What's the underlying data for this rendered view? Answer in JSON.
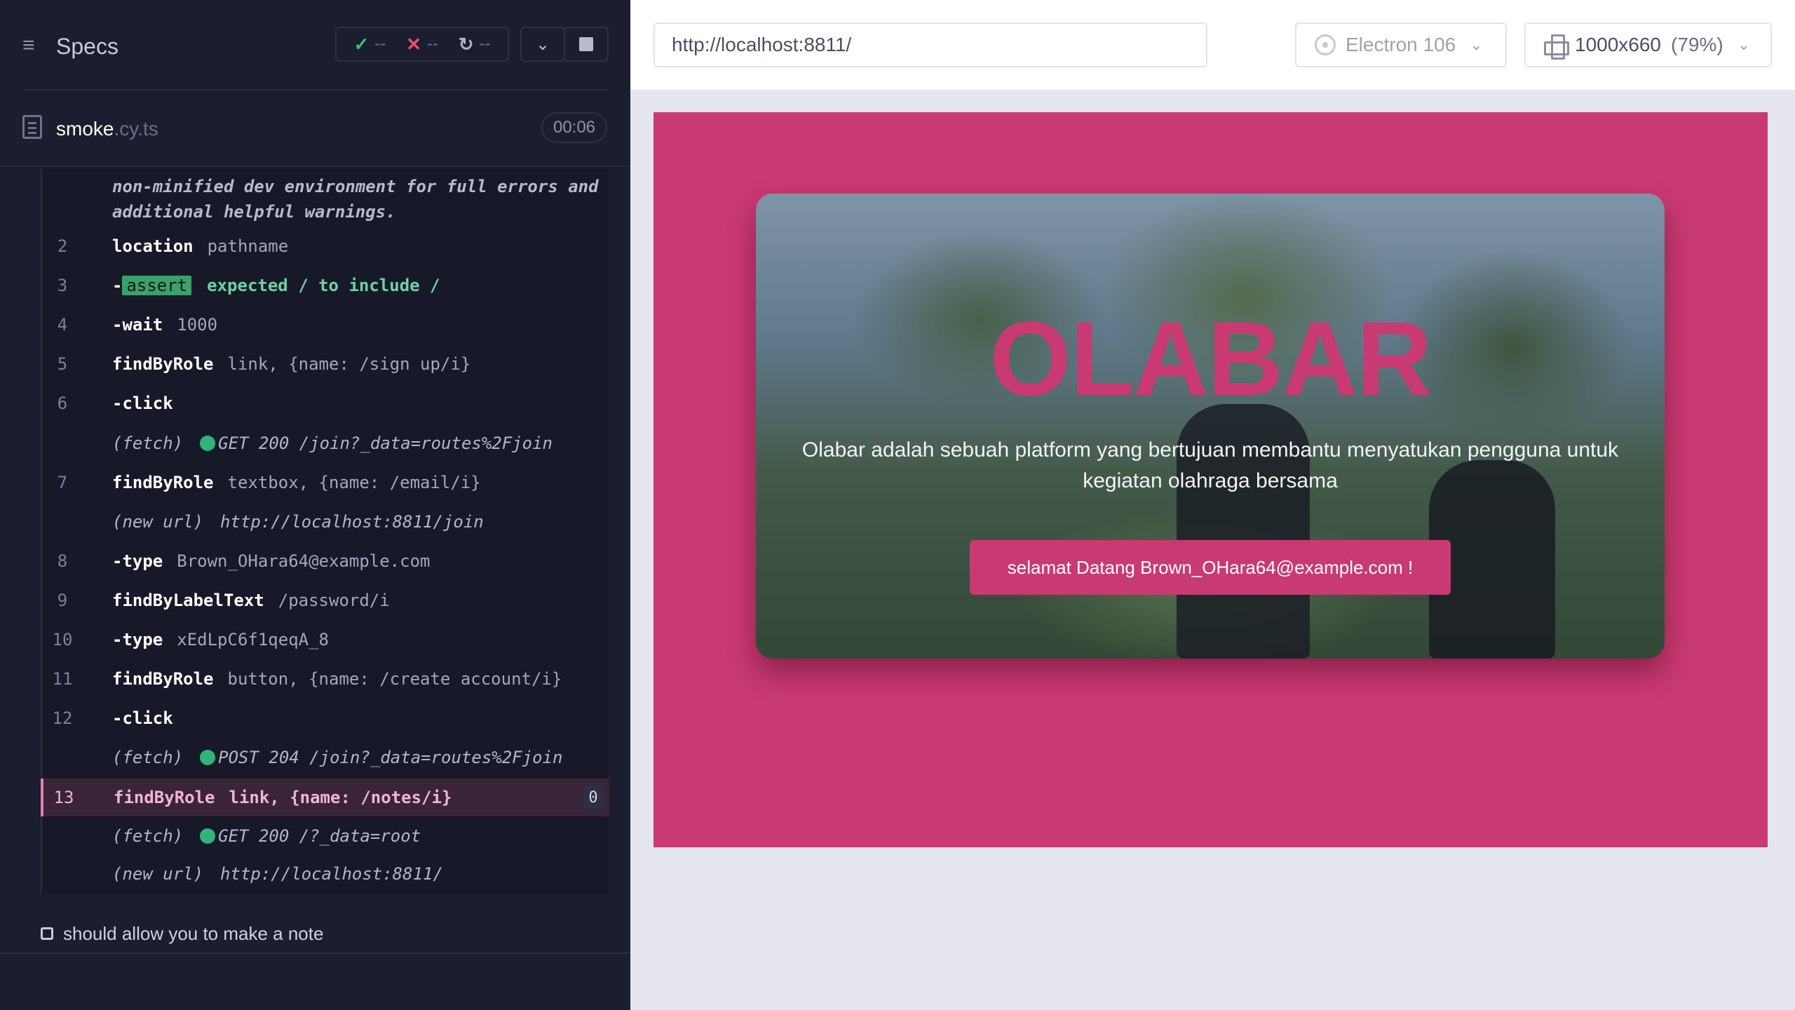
{
  "reporter": {
    "specs_title": "Specs",
    "stats": {
      "passed": "--",
      "failed": "--",
      "pending": "--"
    },
    "spec": {
      "name": "smoke",
      "ext": ".cy.ts",
      "duration": "00:06"
    },
    "error_text": "non-minified dev environment for full errors and additional helpful warnings.",
    "commands": [
      {
        "num": "2",
        "name": "location",
        "msg": "pathname"
      },
      {
        "num": "3",
        "name": "assert",
        "msg": "expected / to include /"
      },
      {
        "num": "4",
        "name": "wait",
        "msg": "1000"
      },
      {
        "num": "5",
        "name": "findByRole",
        "msg": "link, {name: /sign up/i}"
      },
      {
        "num": "6",
        "name": "click",
        "msg": ""
      },
      {
        "num": "",
        "name": "(fetch)",
        "msg": "GET 200 /join?_data=routes%2Fjoin"
      },
      {
        "num": "7",
        "name": "findByRole",
        "msg": "textbox, {name: /email/i}"
      },
      {
        "num": "",
        "name": "(new url)",
        "msg": "http://localhost:8811/join"
      },
      {
        "num": "8",
        "name": "type",
        "msg": "Brown_OHara64@example.com"
      },
      {
        "num": "9",
        "name": "findByLabelText",
        "msg": "/password/i"
      },
      {
        "num": "10",
        "name": "type",
        "msg": "xEdLpC6f1qeqA_8"
      },
      {
        "num": "11",
        "name": "findByRole",
        "msg": "button, {name: /create account/i}"
      },
      {
        "num": "12",
        "name": "click",
        "msg": ""
      },
      {
        "num": "",
        "name": "(fetch)",
        "msg": "POST 204 /join?_data=routes%2Fjoin"
      },
      {
        "num": "13",
        "name": "findByRole",
        "msg": "link, {name: /notes/i}",
        "count": "0"
      },
      {
        "num": "",
        "name": "(fetch)",
        "msg": "GET 200 /?_data=root"
      },
      {
        "num": "",
        "name": "(new url)",
        "msg": "http://localhost:8811/"
      }
    ],
    "next_test": "should allow you to make a note"
  },
  "aut": {
    "url": "http://localhost:8811/",
    "browser": "Electron 106",
    "viewport": "1000x660",
    "scale": "(79%)",
    "hero": {
      "title": "OLABAR",
      "description": "Olabar adalah sebuah platform yang bertujuan membantu menyatukan pengguna untuk kegiatan olahraga bersama",
      "cta": "selamat Datang Brown_OHara64@example.com !"
    }
  },
  "colors": {
    "reporter_bg": "#1b1e2e",
    "app_bg": "#c93a72",
    "pass": "#38c37a",
    "fail": "#ef4f62",
    "active_cmd": "#f3b4d0"
  }
}
